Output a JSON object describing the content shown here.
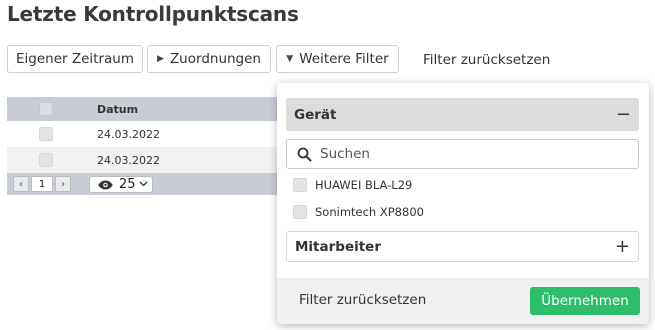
{
  "page": {
    "title": "Letzte Kontrollpunktscans"
  },
  "toolbar": {
    "eigener_zeitraum": "Eigener Zeitraum",
    "zuordnungen": "Zuordnungen",
    "weitere_filter": "Weitere Filter",
    "filter_reset": "Filter zurücksetzen"
  },
  "table": {
    "columns": [
      "Datum"
    ],
    "rows": [
      {
        "datum": "24.03.2022"
      },
      {
        "datum": "24.03.2022"
      }
    ],
    "pager": {
      "prev": "‹",
      "page": "1",
      "next": "›",
      "page_size": "25"
    }
  },
  "filter_panel": {
    "section_geraet": {
      "label": "Gerät",
      "toggle": "−"
    },
    "search_placeholder": "Suchen",
    "options": [
      {
        "label": "HUAWEI BLA-L29",
        "checked": false
      },
      {
        "label": "Sonimtech XP8800",
        "checked": false
      }
    ],
    "section_mitarbeiter": {
      "label": "Mitarbeiter",
      "toggle": "+"
    },
    "footer": {
      "reset": "Filter zurücksetzen",
      "apply": "Übernehmen"
    }
  },
  "colors": {
    "accent_green": "#2ebd6b",
    "table_header": "#c9cdd5"
  },
  "icons": [
    "caret-right-icon",
    "caret-down-icon",
    "eye-icon",
    "chevron-down-icon",
    "search-icon",
    "minus-icon",
    "plus-icon"
  ]
}
